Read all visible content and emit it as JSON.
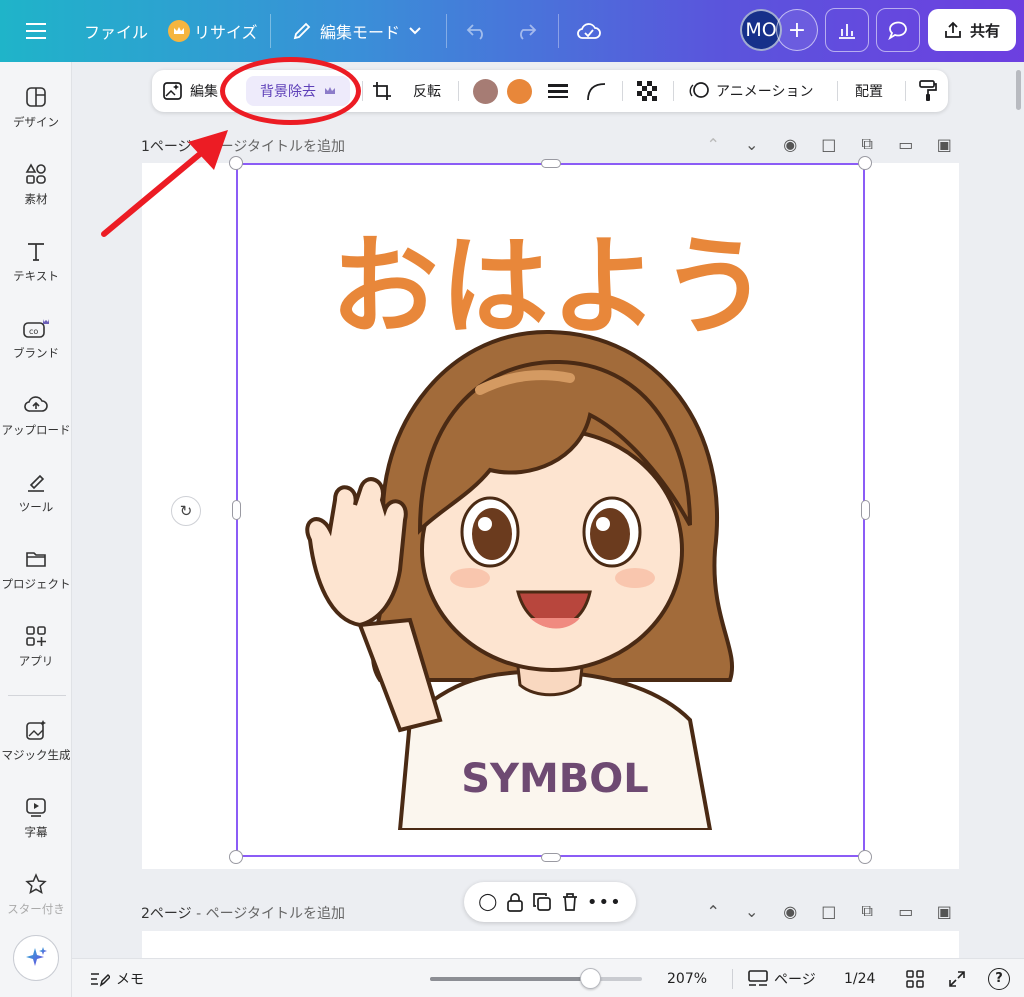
{
  "topbar": {
    "menu_icon": "hamburger-icon",
    "file": "ファイル",
    "resize": "リサイズ",
    "edit_mode": "編集モード",
    "avatar": "MO",
    "share": "共有",
    "colors": {
      "gradient_start": "#1fb4c9",
      "gradient_end": "#6d3fe0"
    }
  },
  "sidebar": {
    "items": [
      {
        "label": "デザイン",
        "icon": "design-icon"
      },
      {
        "label": "素材",
        "icon": "elements-icon"
      },
      {
        "label": "テキスト",
        "icon": "text-icon"
      },
      {
        "label": "ブランド",
        "icon": "brand-icon"
      },
      {
        "label": "アップロード",
        "icon": "upload-icon"
      },
      {
        "label": "ツール",
        "icon": "tools-icon"
      },
      {
        "label": "プロジェクト",
        "icon": "folder-icon"
      },
      {
        "label": "アプリ",
        "icon": "apps-icon"
      },
      {
        "label": "マジック生成",
        "icon": "magic-media-icon"
      },
      {
        "label": "字幕",
        "icon": "captions-icon"
      },
      {
        "label": "スター付き",
        "icon": "star-icon"
      }
    ]
  },
  "context_toolbar": {
    "edit": "編集",
    "bg_remove": "背景除去",
    "flip": "反転",
    "animation": "アニメーション",
    "arrange": "配置",
    "swatch_colors": [
      "#a67c74",
      "#e8873a"
    ]
  },
  "pages": {
    "page1_label": "1ページ",
    "page1_sub": " - ページタイトルを追加",
    "page2_label": "2ページ",
    "page2_sub": " - ページタイトルを追加"
  },
  "canvas": {
    "greeting": "おはよう",
    "shirt_text": "SYMBOL"
  },
  "bottombar": {
    "notes": "メモ",
    "zoom": "207%",
    "zoom_fraction": 0.72,
    "pages": "ページ",
    "page_count": "1/24",
    "help": "?"
  },
  "annotation": {
    "color": "#ec1c24"
  }
}
